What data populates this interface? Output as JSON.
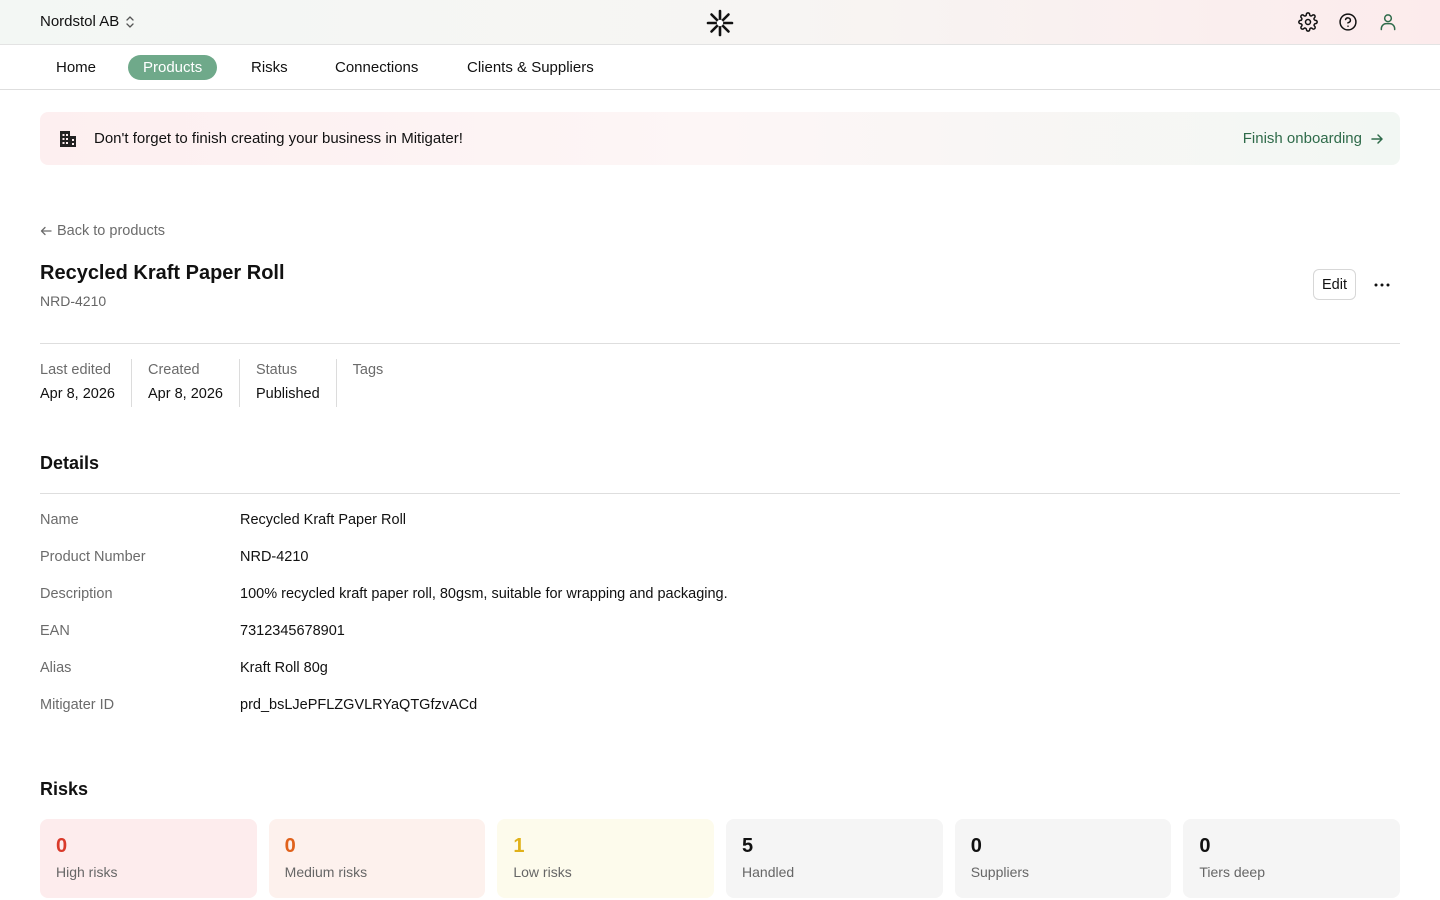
{
  "header": {
    "org_name": "Nordstol AB",
    "icons": [
      "chevron-updown-icon",
      "mitigater-logo",
      "gear-icon",
      "help-icon",
      "user-icon"
    ]
  },
  "nav": {
    "tabs": [
      {
        "label": "Home",
        "active": false
      },
      {
        "label": "Products",
        "active": true
      },
      {
        "label": "Risks",
        "active": false
      },
      {
        "label": "Connections",
        "active": false
      },
      {
        "label": "Clients & Suppliers",
        "active": false
      }
    ]
  },
  "banner": {
    "text": "Don't forget to finish creating your business in Mitigater!",
    "link": "Finish onboarding"
  },
  "back_link": "Back to products",
  "product": {
    "title": "Recycled Kraft Paper Roll",
    "number": "NRD-4210",
    "edit_label": "Edit"
  },
  "meta": [
    {
      "label": "Last edited",
      "value": "Apr 8, 2026"
    },
    {
      "label": "Created",
      "value": "Apr 8, 2026"
    },
    {
      "label": "Status",
      "value": "Published"
    },
    {
      "label": "Tags",
      "value": ""
    }
  ],
  "details": {
    "heading": "Details",
    "rows": [
      {
        "label": "Name",
        "value": "Recycled Kraft Paper Roll"
      },
      {
        "label": "Product Number",
        "value": "NRD-4210"
      },
      {
        "label": "Description",
        "value": "100% recycled kraft paper roll, 80gsm, suitable for wrapping and packaging."
      },
      {
        "label": "EAN",
        "value": "7312345678901"
      },
      {
        "label": "Alias",
        "value": "Kraft Roll 80g"
      },
      {
        "label": "Mitigater ID",
        "value": "prd_bsLJePFLZGVLRYaQTGfzvACd"
      }
    ]
  },
  "risks": {
    "heading": "Risks",
    "cards": [
      {
        "value": "0",
        "label": "High risks",
        "value_color": "#d93a2b",
        "bg": "#fdeced"
      },
      {
        "value": "0",
        "label": "Medium risks",
        "value_color": "#e0621c",
        "bg": "#fdf1ed"
      },
      {
        "value": "1",
        "label": "Low risks",
        "value_color": "#e0b11a",
        "bg": "#fdfbec"
      },
      {
        "value": "5",
        "label": "Handled",
        "value_color": "#111111",
        "bg": "#f5f5f5"
      },
      {
        "value": "0",
        "label": "Suppliers",
        "value_color": "#111111",
        "bg": "#f5f5f5"
      },
      {
        "value": "0",
        "label": "Tiers deep",
        "value_color": "#111111",
        "bg": "#f5f5f5"
      }
    ]
  },
  "colors": {
    "accent": "#6fa98a",
    "link_green": "#2f6b4a"
  }
}
